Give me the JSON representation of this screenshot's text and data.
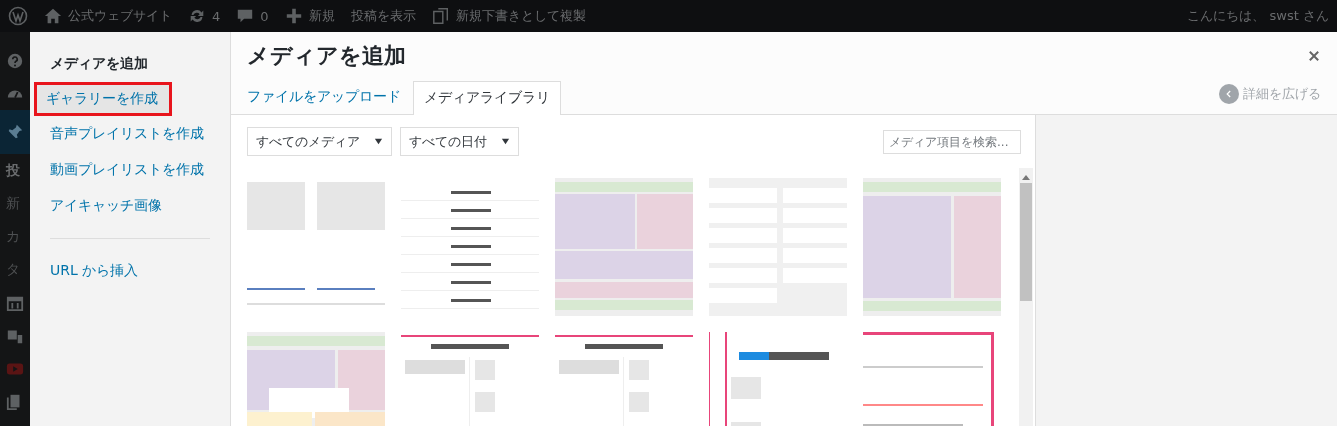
{
  "admin_bar": {
    "site": "公式ウェブサイト",
    "updates": "4",
    "comments": "0",
    "new": "新規",
    "view_post": "投稿を表示",
    "duplicate": "新規下書きとして複製",
    "greeting": "こんにちは、 swst さん"
  },
  "admin_menu": [
    {
      "kind": "icon"
    },
    {
      "kind": "icon"
    },
    {
      "kind": "icon",
      "selected": true
    },
    {
      "kind": "text",
      "label": "投",
      "bold": true
    },
    {
      "kind": "text",
      "label": "新",
      "bold": false
    },
    {
      "kind": "text",
      "label": "カ",
      "bold": false
    },
    {
      "kind": "text",
      "label": "タ",
      "bold": false
    },
    {
      "kind": "icon"
    },
    {
      "kind": "icon"
    },
    {
      "kind": "icon"
    },
    {
      "kind": "icon"
    }
  ],
  "modal": {
    "menu": [
      {
        "label": "メディアを追加",
        "selected": true,
        "marked": false
      },
      {
        "label": "ギャラリーを作成",
        "selected": false,
        "marked": true
      },
      {
        "label": "音声プレイリストを作成",
        "selected": false,
        "marked": false
      },
      {
        "label": "動画プレイリストを作成",
        "selected": false,
        "marked": false
      },
      {
        "label": "アイキャッチ画像",
        "selected": false,
        "marked": false
      }
    ],
    "menu_bottom": [
      {
        "label": "URL から挿入",
        "selected": false,
        "marked": false
      }
    ],
    "title": "メディアを追加",
    "tabs": [
      {
        "label": "ファイルをアップロード",
        "selected": false
      },
      {
        "label": "メディアライブラリ",
        "selected": true
      }
    ],
    "expand": "詳細を広げる",
    "filters": [
      "すべてのメディア",
      "すべての日付"
    ],
    "search": {
      "placeholder": "メディア項目を検索..."
    },
    "thumbnails": [
      {
        "kind": "cards"
      },
      {
        "kind": "rows"
      },
      {
        "kind": "stacked"
      },
      {
        "kind": "widgets"
      },
      {
        "kind": "two-col"
      },
      {
        "kind": "mixed"
      },
      {
        "kind": "article"
      },
      {
        "kind": "article"
      },
      {
        "kind": "split"
      },
      {
        "kind": "frame"
      }
    ]
  }
}
